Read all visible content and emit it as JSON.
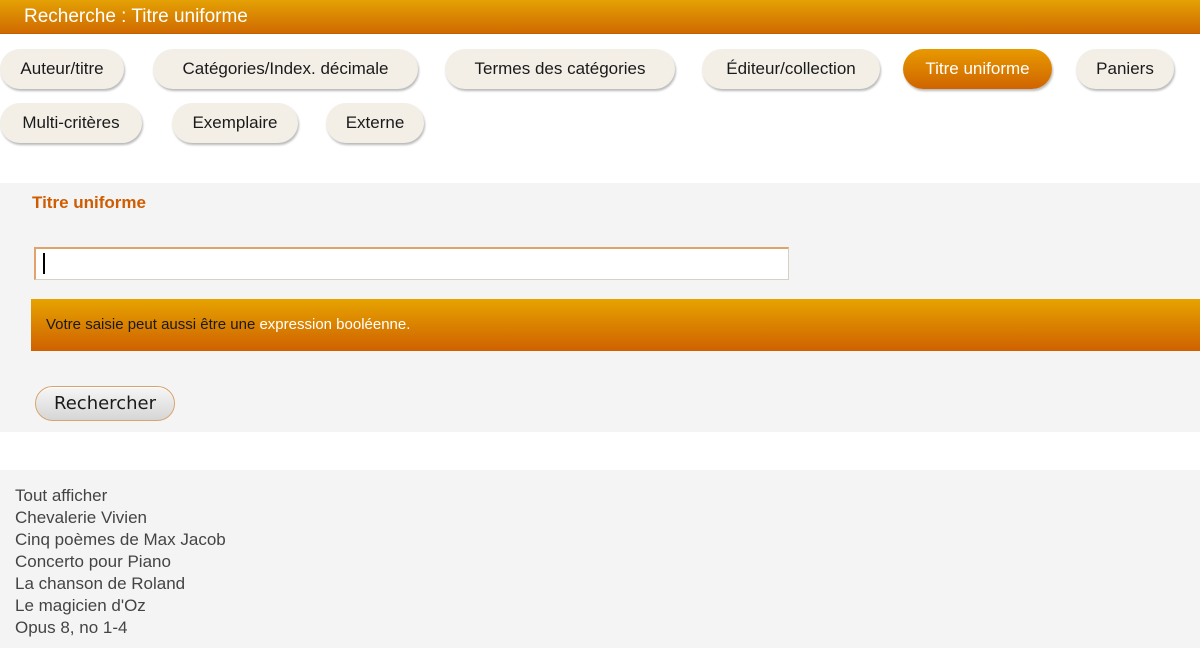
{
  "header": {
    "title": "Recherche : Titre uniforme"
  },
  "tabs": [
    {
      "label": "Auteur/titre",
      "active": false
    },
    {
      "label": "Catégories/Index. décimale",
      "active": false
    },
    {
      "label": "Termes des catégories",
      "active": false
    },
    {
      "label": "Éditeur/collection",
      "active": false
    },
    {
      "label": "Titre uniforme",
      "active": true
    },
    {
      "label": "Paniers",
      "active": false
    },
    {
      "label": "Multi-critères",
      "active": false
    },
    {
      "label": "Exemplaire",
      "active": false
    },
    {
      "label": "Externe",
      "active": false
    }
  ],
  "search": {
    "section_title": "Titre uniforme",
    "input_value": "",
    "info_text": "Votre saisie peut aussi être une",
    "info_link": "expression booléenne.",
    "button_label": "Rechercher"
  },
  "results": [
    "Tout afficher",
    "Chevalerie Vivien",
    "Cinq poèmes de Max Jacob",
    "Concerto pour Piano",
    "La chanson de Roland",
    "Le magicien d'Oz",
    "Opus 8, no 1-4"
  ],
  "colors": {
    "accent_orange": "#d06a00",
    "accent_gold": "#e4a104",
    "section_title": "#cf5c00",
    "panel_bg": "#f4f4f4",
    "tab_bg": "#f3efe7"
  }
}
